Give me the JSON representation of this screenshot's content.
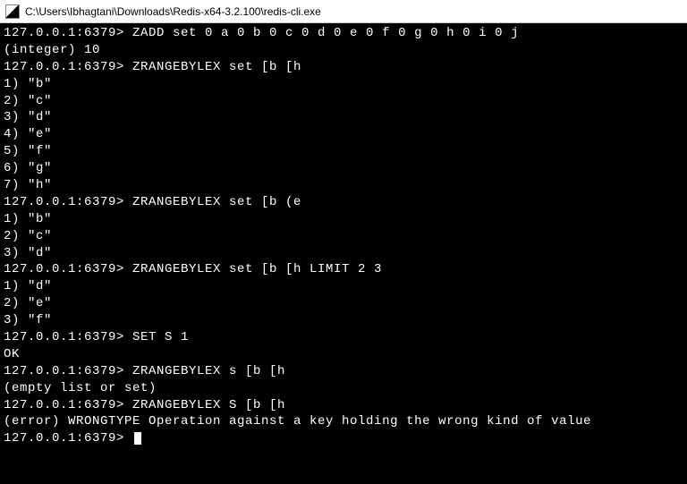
{
  "window": {
    "title": "C:\\Users\\Ibhagtani\\Downloads\\Redis-x64-3.2.100\\redis-cli.exe"
  },
  "terminal": {
    "prompt": "127.0.0.1:6379>",
    "lines": [
      {
        "type": "cmd",
        "text": "ZADD set 0 a 0 b 0 c 0 d 0 e 0 f 0 g 0 h 0 i 0 j"
      },
      {
        "type": "out",
        "text": "(integer) 10"
      },
      {
        "type": "cmd",
        "text": "ZRANGEBYLEX set [b [h"
      },
      {
        "type": "out",
        "text": "1) \"b\""
      },
      {
        "type": "out",
        "text": "2) \"c\""
      },
      {
        "type": "out",
        "text": "3) \"d\""
      },
      {
        "type": "out",
        "text": "4) \"e\""
      },
      {
        "type": "out",
        "text": "5) \"f\""
      },
      {
        "type": "out",
        "text": "6) \"g\""
      },
      {
        "type": "out",
        "text": "7) \"h\""
      },
      {
        "type": "cmd",
        "text": "ZRANGEBYLEX set [b (e"
      },
      {
        "type": "out",
        "text": "1) \"b\""
      },
      {
        "type": "out",
        "text": "2) \"c\""
      },
      {
        "type": "out",
        "text": "3) \"d\""
      },
      {
        "type": "cmd",
        "text": "ZRANGEBYLEX set [b [h LIMIT 2 3"
      },
      {
        "type": "out",
        "text": "1) \"d\""
      },
      {
        "type": "out",
        "text": "2) \"e\""
      },
      {
        "type": "out",
        "text": "3) \"f\""
      },
      {
        "type": "cmd",
        "text": "SET S 1"
      },
      {
        "type": "out",
        "text": "OK"
      },
      {
        "type": "cmd",
        "text": "ZRANGEBYLEX s [b [h"
      },
      {
        "type": "out",
        "text": "(empty list or set)"
      },
      {
        "type": "cmd",
        "text": "ZRANGEBYLEX S [b [h"
      },
      {
        "type": "out",
        "text": "(error) WRONGTYPE Operation against a key holding the wrong kind of value"
      },
      {
        "type": "cmd-cursor",
        "text": ""
      }
    ]
  }
}
